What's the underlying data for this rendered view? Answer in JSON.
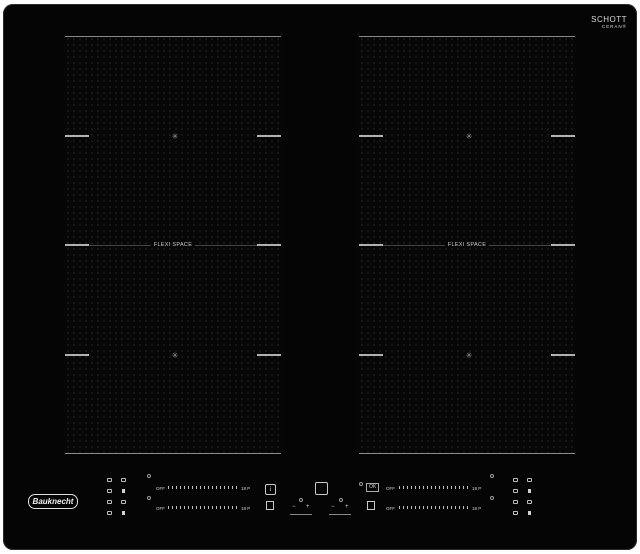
{
  "brand": {
    "logo_text": "Bauknecht",
    "glass_brand_line1": "SCHOTT",
    "glass_brand_line2": "CERAN®"
  },
  "zones": {
    "left_flexi_label": "FLEXI SPACE",
    "right_flexi_label": "FLEXI SPACE"
  },
  "controls": {
    "slider_off": "OFF",
    "slider_max": "18 P",
    "power_icon": "i",
    "ok_label": "OK",
    "minus": "−",
    "plus": "+",
    "timer_icon": "timer-icon",
    "menu_icon": "menu-icon",
    "lock_icon": "lock-icon"
  },
  "colors": {
    "glass": "#050505",
    "print": "#d0d0d0",
    "zone_edge": "#8a8a8a"
  }
}
